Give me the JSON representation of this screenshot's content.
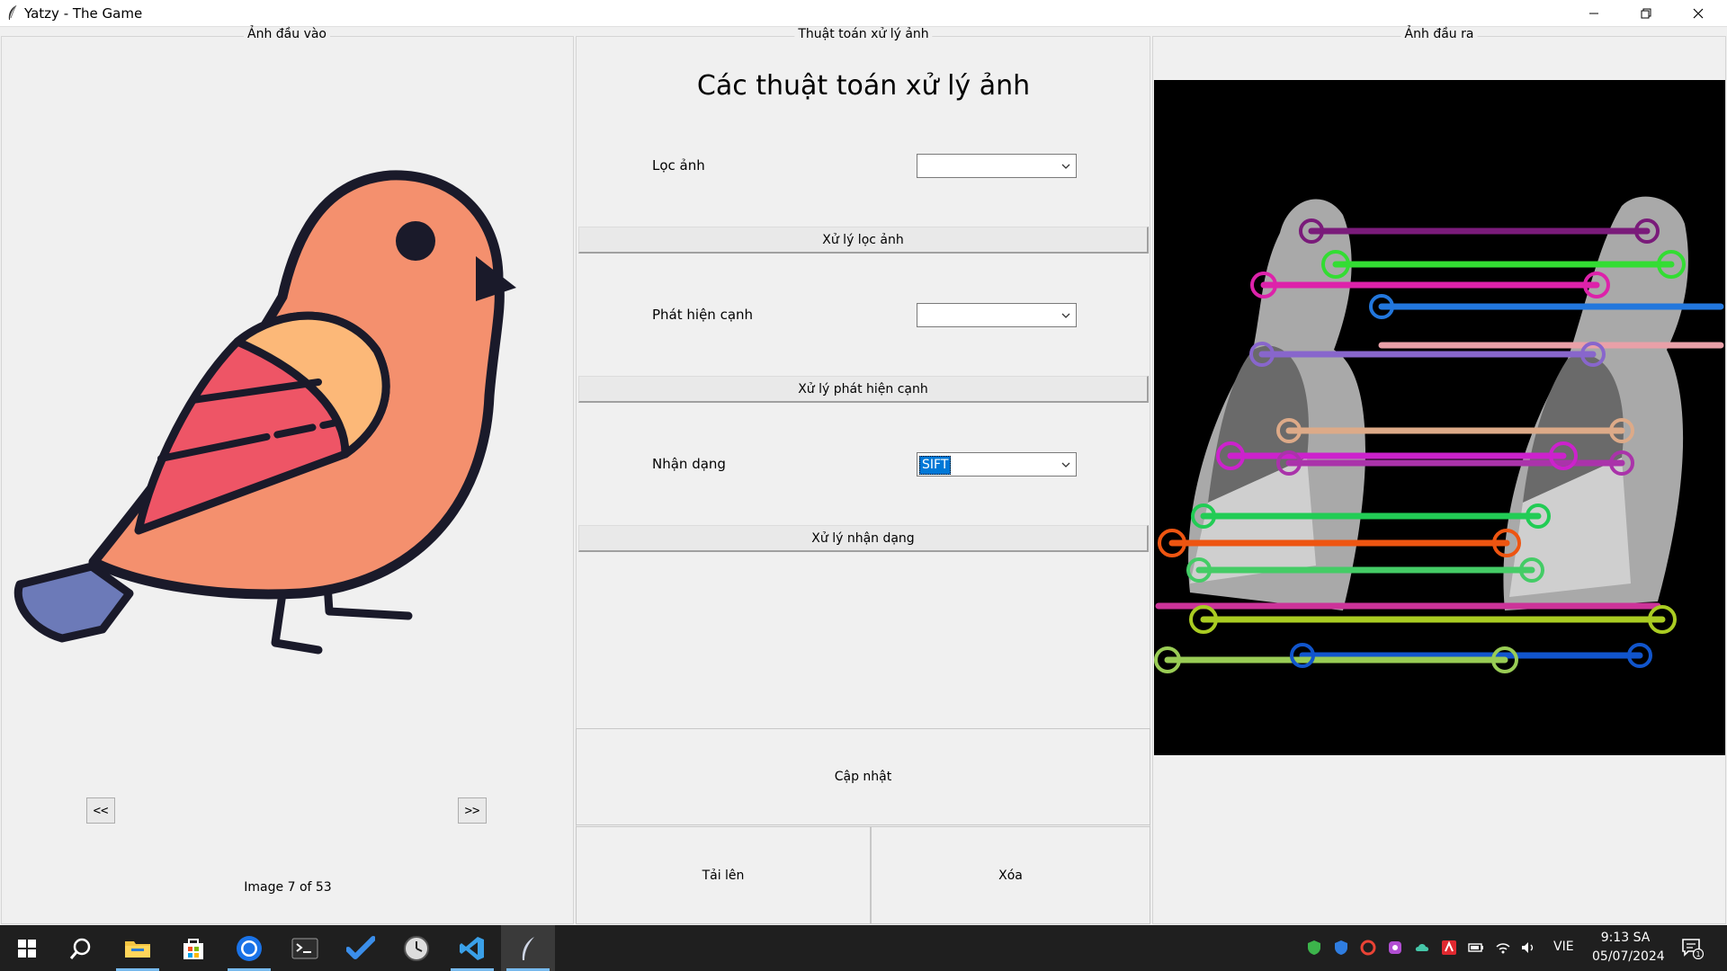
{
  "window": {
    "title": "Yatzy - The Game"
  },
  "panels": {
    "input": {
      "label": "Ảnh đầu vào",
      "prev_label": "<<",
      "next_label": ">>",
      "counter": "Image 7 of 53"
    },
    "algorithms": {
      "label": "Thuật toán xử lý ảnh",
      "heading": "Các thuật toán xử lý ảnh",
      "filter": {
        "label": "Lọc ảnh",
        "value": "",
        "button": "Xử lý lọc ảnh"
      },
      "edge": {
        "label": "Phát hiện cạnh",
        "value": "",
        "button": "Xử lý phát hiện cạnh"
      },
      "recognition": {
        "label": "Nhận dạng",
        "value": "SIFT",
        "button": "Xử lý nhận dạng"
      },
      "update_button": "Cập nhật",
      "upload_button": "Tải lên",
      "delete_button": "Xóa"
    },
    "output": {
      "label": "Ảnh đầu ra"
    }
  },
  "taskbar": {
    "apps": [
      "windows-start-icon",
      "search-icon",
      "file-explorer-icon",
      "microsoft-store-icon",
      "chrome-icon",
      "terminal-icon",
      "todo-icon",
      "clock-app-icon",
      "vscode-icon",
      "python-feather-icon"
    ],
    "language": "VIE",
    "time": "9:13 SA",
    "date": "05/07/2024",
    "notification_count": "1"
  },
  "colors": {
    "accent": "#0078d7",
    "bird_body": "#f4906e",
    "bird_wing_stripes": "#ee5566",
    "bird_wing_top": "#fcb878",
    "bird_tail": "#6c7ab8",
    "output_background": "#000000"
  }
}
